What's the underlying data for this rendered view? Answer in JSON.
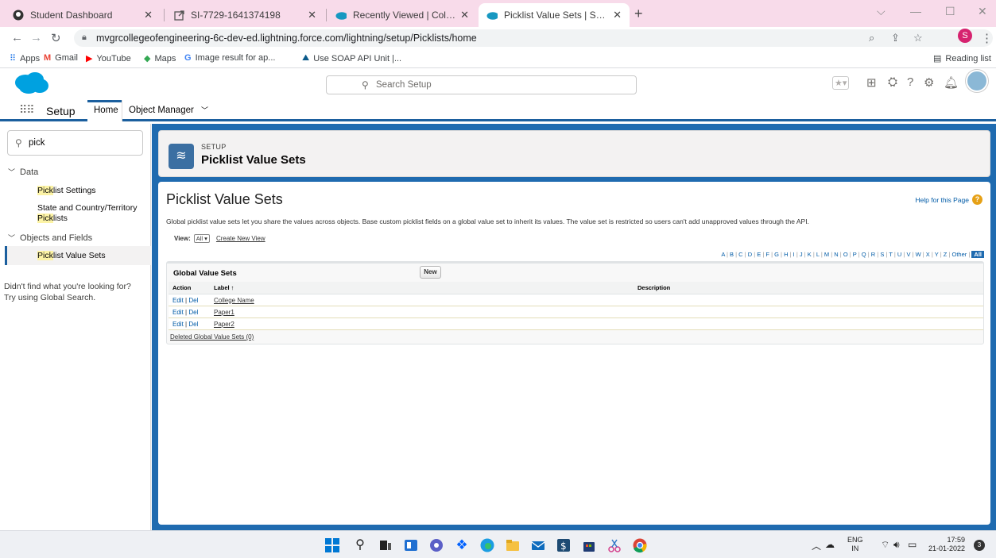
{
  "browser": {
    "tabs": [
      {
        "title": "Student Dashboard",
        "icon": "github-icon"
      },
      {
        "title": "SI-7729-1641374198",
        "icon": "external-link-icon"
      },
      {
        "title": "Recently Viewed | Colleges | Sale",
        "icon": "salesforce-cloud-icon"
      },
      {
        "title": "Picklist Value Sets | Salesforce",
        "icon": "salesforce-cloud-icon"
      }
    ],
    "url": "mvgrcollegeofengineering-6c-dev-ed.lightning.force.com/lightning/setup/Picklists/home",
    "profile_initial": "S",
    "bookmarks": [
      "Apps",
      "Gmail",
      "YouTube",
      "Maps",
      "Image result for ap...",
      "Use SOAP API Unit |..."
    ],
    "reading_list": "Reading list"
  },
  "sf": {
    "search_placeholder": "Search Setup",
    "app_name": "Setup",
    "nav_home": "Home",
    "nav_object_manager": "Object Manager"
  },
  "sidebar": {
    "quickfind_value": "pick",
    "sections": {
      "data": "Data",
      "objects_fields": "Objects and Fields"
    },
    "items": {
      "picklist_settings_hl": "Pick",
      "picklist_settings_rest": "list Settings",
      "state_country_1": "State and Country/Territory",
      "state_country_hl": "Pick",
      "state_country_rest": "lists",
      "picklist_value_sets_hl": "Pick",
      "picklist_value_sets_rest": "list Value Sets"
    },
    "help_line1": "Didn't find what you're looking for?",
    "help_line2": "Try using Global Search."
  },
  "page": {
    "setup_label": "SETUP",
    "header_title": "Picklist Value Sets",
    "content_title": "Picklist Value Sets",
    "help_link": "Help for this Page",
    "description": "Global picklist value sets let you share the values across objects. Base custom picklist fields on a global value set to inherit its values. The value set is restricted so users can't add unapproved values through the API.",
    "view_label": "View:",
    "view_value": "All",
    "create_view": "Create New View",
    "alphabet": [
      "A",
      "B",
      "C",
      "D",
      "E",
      "F",
      "G",
      "H",
      "I",
      "J",
      "K",
      "L",
      "M",
      "N",
      "O",
      "P",
      "Q",
      "R",
      "S",
      "T",
      "U",
      "V",
      "W",
      "X",
      "Y",
      "Z",
      "Other"
    ],
    "alphabet_all": "All",
    "block_title": "Global Value Sets",
    "new_button": "New",
    "columns": [
      "Action",
      "Label ↑",
      "Description"
    ],
    "rows": [
      {
        "edit": "Edit",
        "del": "Del",
        "label": "College Name",
        "description": ""
      },
      {
        "edit": "Edit",
        "del": "Del",
        "label": "Paper1",
        "description": ""
      },
      {
        "edit": "Edit",
        "del": "Del",
        "label": "Paper2",
        "description": ""
      }
    ],
    "deleted_link": "Deleted Global Value Sets (0)"
  },
  "taskbar": {
    "lang_line1": "ENG",
    "lang_line2": "IN",
    "time": "17:59",
    "date": "21-01-2022",
    "notification_count": "3"
  },
  "colors": {
    "tab_strip": "#f8dbea",
    "salesforce_blue": "#1f6bb0",
    "link_blue": "#015ba7",
    "highlight": "#fcf3a5"
  }
}
